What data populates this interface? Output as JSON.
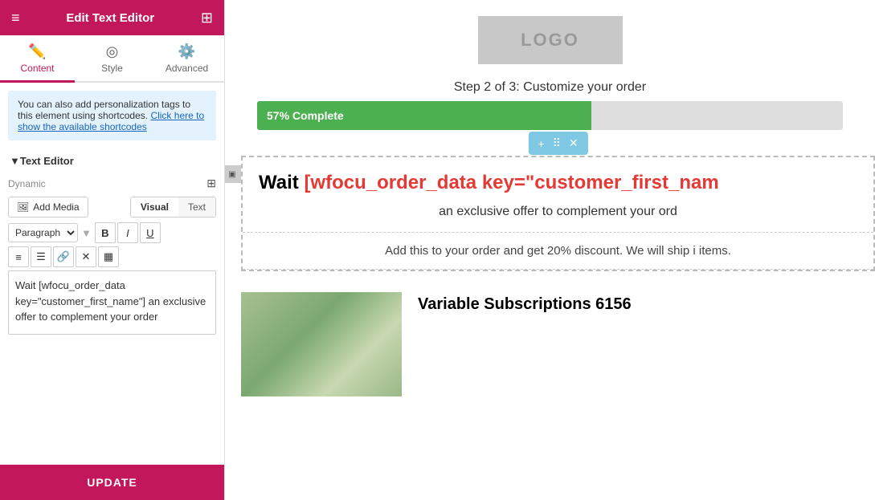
{
  "topbar": {
    "title": "Edit Text Editor",
    "hamburger_icon": "≡",
    "grid_icon": "⊞"
  },
  "tabs": [
    {
      "id": "content",
      "label": "Content",
      "icon": "✏",
      "active": true
    },
    {
      "id": "style",
      "label": "Style",
      "icon": "◎",
      "active": false
    },
    {
      "id": "advanced",
      "label": "Advanced",
      "icon": "⚙",
      "active": false
    }
  ],
  "infobox": {
    "text1": "You can also add personalization tags to this element using shortcodes.",
    "link_text": "Click here to show the available shortcodes"
  },
  "section": {
    "label": "Text Editor",
    "collapsed": false
  },
  "editor": {
    "dynamic_label": "Dynamic",
    "add_media_label": "Add Media",
    "media_icon": "🖼",
    "visual_tab": "Visual",
    "text_tab": "Text",
    "active_tab": "Visual",
    "format_options": [
      "Paragraph"
    ],
    "format_selected": "Paragraph",
    "bold_label": "B",
    "italic_label": "I",
    "underline_label": "U",
    "content": "Wait [wfocu_order_data key=\"customer_first_name\"] an exclusive offer to complement your order"
  },
  "bottom": {
    "update_label": "UPDATE"
  },
  "page": {
    "logo_text": "LOGO",
    "step_text": "Step 2 of 3: Customize your order",
    "progress_label": "57% Complete",
    "progress_percent": 57,
    "main_heading_prefix": "Wait ",
    "main_heading_shortcode": "[wfocu_order_data key=\"customer_first_nam",
    "main_heading_suffix": "",
    "subtext": "an exclusive offer to complement your ord",
    "offer_text": "Add this to your order and get 20% discount. We will ship i items.",
    "product_title": "Variable Subscriptions 6156"
  }
}
